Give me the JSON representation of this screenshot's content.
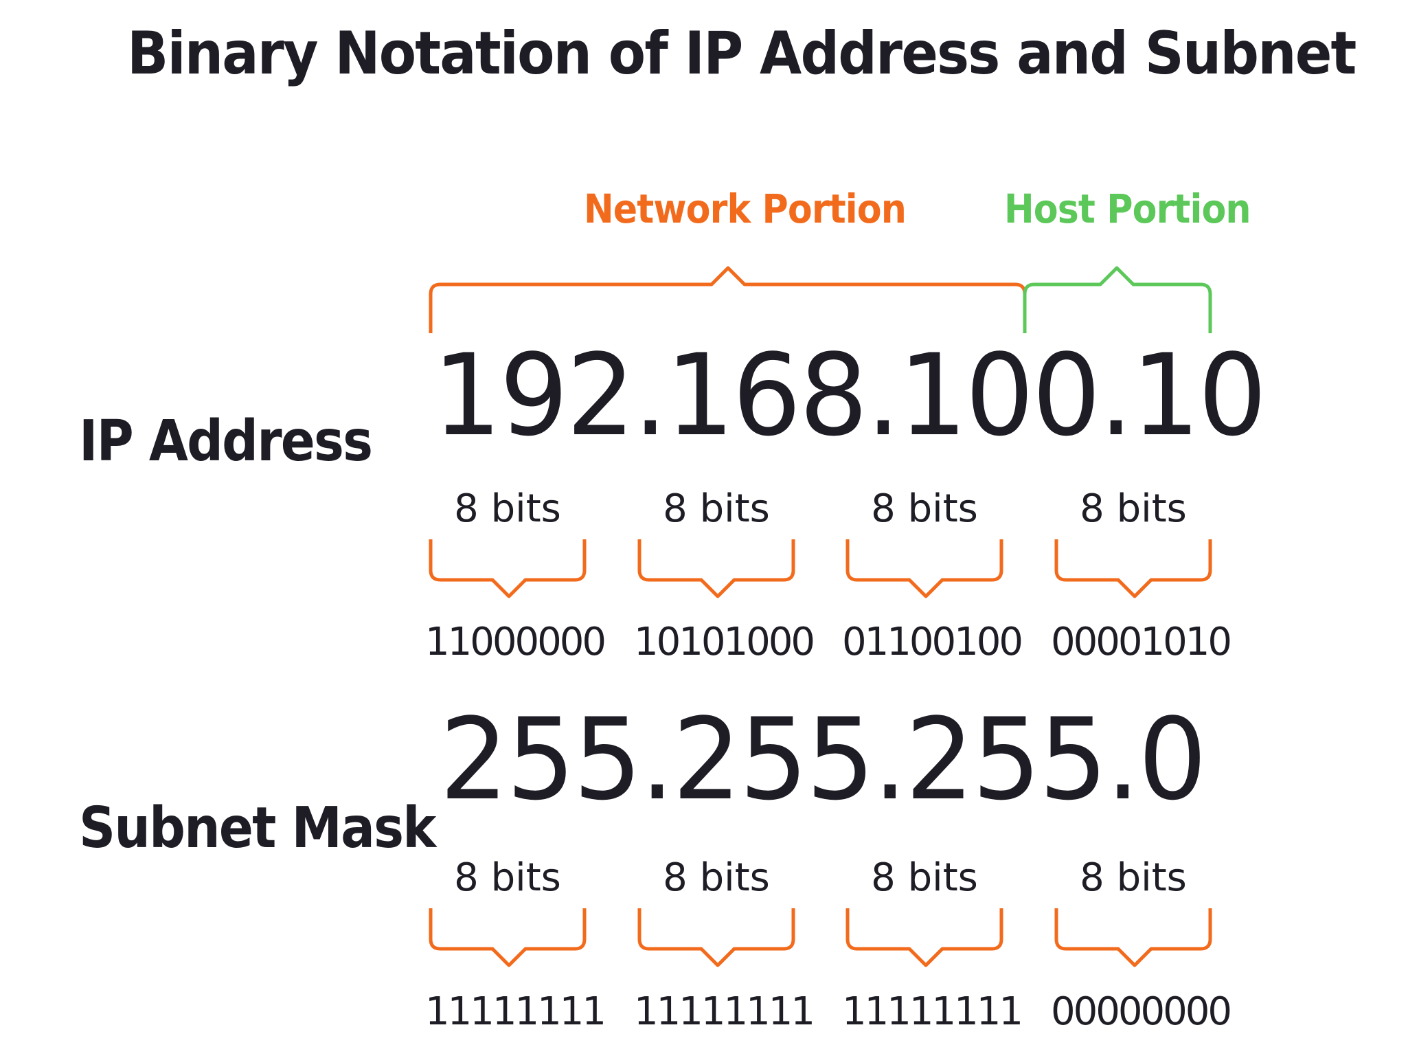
{
  "title": "Binary Notation of IP Address and Subnet",
  "portions": {
    "network": "Network Portion",
    "host": "Host Portion"
  },
  "colors": {
    "network": "#f26b1d",
    "host": "#5cc85a",
    "text": "#1e1c24"
  },
  "rows": {
    "ip": {
      "label": "IP Address",
      "value": "192.168.100.10",
      "octets": [
        {
          "bits": "8 bits",
          "binary": "11000000"
        },
        {
          "bits": "8 bits",
          "binary": "10101000"
        },
        {
          "bits": "8 bits",
          "binary": "01100100"
        },
        {
          "bits": "8 bits",
          "binary": "00001010"
        }
      ]
    },
    "mask": {
      "label": "Subnet Mask",
      "value": "255.255.255.0",
      "octets": [
        {
          "bits": "8 bits",
          "binary": "11111111"
        },
        {
          "bits": "8 bits",
          "binary": "11111111"
        },
        {
          "bits": "8 bits",
          "binary": "11111111"
        },
        {
          "bits": "8 bits",
          "binary": "00000000"
        }
      ]
    }
  }
}
